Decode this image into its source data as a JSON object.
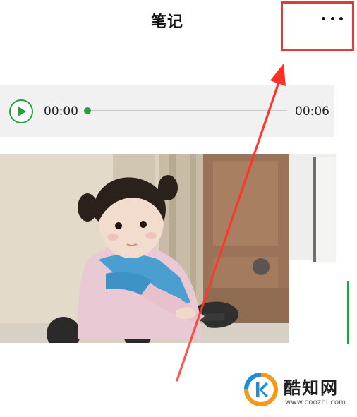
{
  "header": {
    "title": "笔记",
    "more_icon": "more-horizontal-icon"
  },
  "audio": {
    "play_icon": "play-icon",
    "current_time": "00:00",
    "total_time": "00:06",
    "progress": 0,
    "accent_color": "#22a33e"
  },
  "image": {
    "subject": "photo of a little girl with pigtails in a pink sweater on a ride-on toy"
  },
  "annotation": {
    "highlight_color": "#e53935",
    "arrow_icon": "red-arrow-icon"
  },
  "watermark": {
    "name": "酷知网",
    "url": "www.coozhi.com"
  }
}
